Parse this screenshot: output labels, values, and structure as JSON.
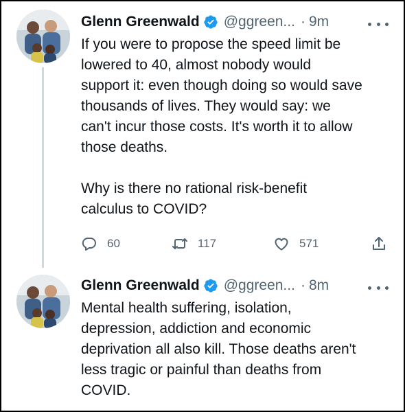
{
  "tweets": [
    {
      "author": "Glenn Greenwald",
      "handle": "@ggreen...",
      "separator": "·",
      "time": "9m",
      "verified": true,
      "text": "If you were to propose the speed limit be\nlowered to 40, almost nobody would\nsupport it: even though doing so would save\nthousands of lives. They would say: we\ncan't incur those costs. It's worth it to allow\nthose deaths.\n\nWhy is there no rational risk-benefit\ncalculus to COVID?",
      "stats": {
        "replies": "60",
        "retweets": "117",
        "likes": "571"
      }
    },
    {
      "author": "Glenn Greenwald",
      "handle": "@ggreen...",
      "separator": "·",
      "time": "8m",
      "verified": true,
      "text": "Mental health suffering, isolation,\ndepression, addiction and economic\ndeprivation all also kill. Those deaths aren't\nless tragic or painful than deaths from\nCOVID."
    }
  ],
  "icons": {
    "verified": "verified-badge-icon",
    "more": "more-dots-icon",
    "reply": "speech-bubble-icon",
    "retweet": "retweet-arrows-icon",
    "like": "heart-icon",
    "share": "share-upload-icon"
  },
  "colors": {
    "text": "#0f1419",
    "muted": "#536471",
    "verified": "#1d9bf0",
    "thread_line": "#cfd9de",
    "frame_border": "#000000"
  }
}
